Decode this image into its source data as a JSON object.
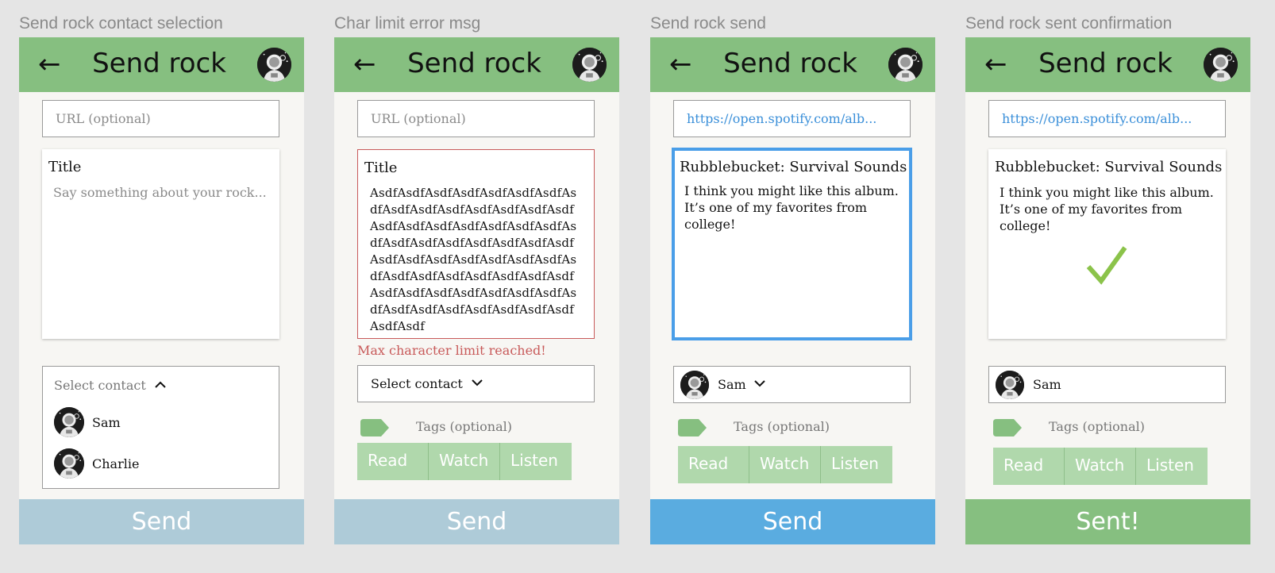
{
  "frames": [
    {
      "label": "Send rock contact selection",
      "header_title": "Send rock",
      "url_placeholder": "URL (optional)",
      "card_title": "Title",
      "card_placeholder": "Say something about your rock...",
      "contact_label": "Select contact",
      "contacts": [
        "Sam",
        "Charlie"
      ],
      "send_label": "Send"
    },
    {
      "label": "Char limit error msg",
      "header_title": "Send rock",
      "url_placeholder": "URL (optional)",
      "card_title": "Title",
      "card_body": "AsdfAsdfAsdfAsdfAsdfAsdfAsdfAsdfAsdfAsdfAsdfAsdfAsdfAsdfAsdfAsdfAsdfAsdfAsdfAsdfAsdfAsdfAsdfAsdfAsdfAsdfAsdfAsdfAsdfAsdfAsdfAsdfAsdfAsdfAsdfAsdfAsdfAsdfAsdfAsdfAsdfAsdfAsdfAsdfAsdfAsdfAsdfAsdfAsdfAsdfAsdfAsdfAsdfAsdfAsdfAsdfAsdfAsdfAsdfAsdfAsdfAsdf",
      "error_msg": "Max character limit reached!",
      "contact_label": "Select contact",
      "tags_label": "Tags (optional)",
      "tags": [
        "Read",
        "Watch",
        "Listen"
      ],
      "send_label": "Send"
    },
    {
      "label": "Send rock send",
      "header_title": "Send rock",
      "url_value": "https://open.spotify.com/alb...",
      "card_title": "Rubblebucket: Survival Sounds",
      "card_body": "I think you might like this album. It’s one of my favorites from college!",
      "selected_contact": "Sam",
      "tags_label": "Tags (optional)",
      "tags": [
        "Read",
        "Watch",
        "Listen"
      ],
      "send_label": "Send"
    },
    {
      "label": "Send rock sent confirmation",
      "header_title": "Send rock",
      "url_value": "https://open.spotify.com/alb...",
      "card_title": "Rubblebucket: Survival Sounds",
      "card_body": "I think you might like this album. It’s one of my favorites from college!",
      "selected_contact": "Sam",
      "tags_label": "Tags (optional)",
      "tags": [
        "Read",
        "Watch",
        "Listen"
      ],
      "send_label": "Sent!"
    }
  ],
  "icons": {
    "back": "arrow-left-icon",
    "contact_toggle": "chevron-icon",
    "tag": "tag-icon",
    "confirm": "checkmark-icon",
    "avatar": "astronaut-avatar"
  },
  "colors": {
    "header": "#86bf80",
    "send_disabled": "#aecbd8",
    "send_active": "#5aace0",
    "sent": "#86bf80",
    "error": "#c85a5a",
    "link": "#3a8fd9",
    "tag_buttons": "#b0d8ac",
    "check": "#8bc34a"
  }
}
